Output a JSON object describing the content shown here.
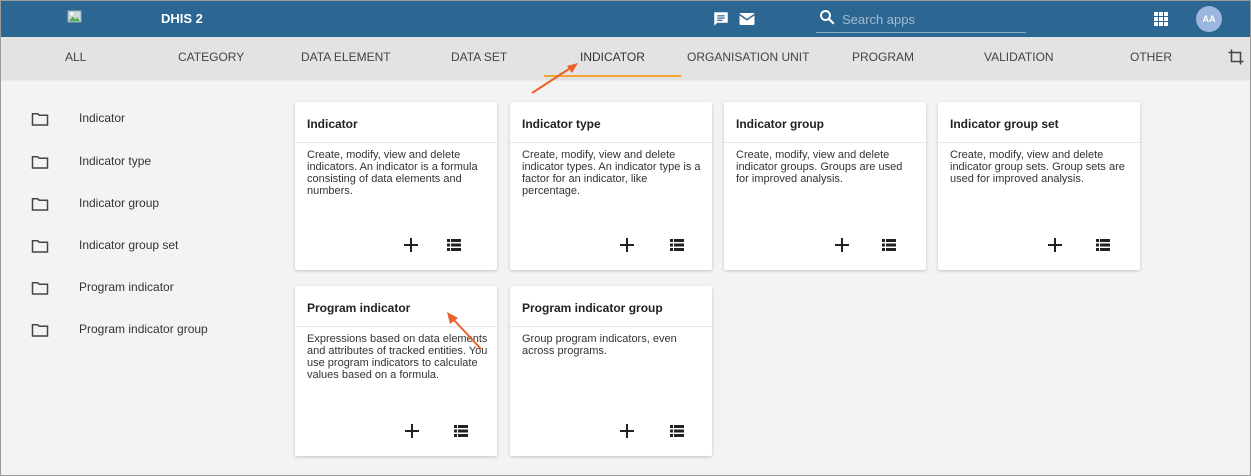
{
  "header": {
    "app_title": "DHIS 2",
    "search_placeholder": "Search apps",
    "avatar_initials": "AA",
    "color": "#2c6693"
  },
  "tabs": [
    {
      "label": "ALL"
    },
    {
      "label": "CATEGORY"
    },
    {
      "label": "DATA ELEMENT"
    },
    {
      "label": "DATA SET"
    },
    {
      "label": "INDICATOR",
      "active": true
    },
    {
      "label": "ORGANISATION UNIT"
    },
    {
      "label": "PROGRAM"
    },
    {
      "label": "VALIDATION"
    },
    {
      "label": "OTHER"
    }
  ],
  "accent_color": "#f2a534",
  "sidebar": {
    "items": [
      {
        "label": "Indicator"
      },
      {
        "label": "Indicator type"
      },
      {
        "label": "Indicator group"
      },
      {
        "label": "Indicator group set"
      },
      {
        "label": "Program indicator"
      },
      {
        "label": "Program indicator group"
      }
    ]
  },
  "cards": [
    {
      "title": "Indicator",
      "description": "Create, modify, view and delete indicators. An indicator is a formula consisting of data elements and numbers."
    },
    {
      "title": "Indicator type",
      "description": "Create, modify, view and delete indicator types. An indicator type is a factor for an indicator, like percentage."
    },
    {
      "title": "Indicator group",
      "description": "Create, modify, view and delete indicator groups. Groups are used for improved analysis."
    },
    {
      "title": "Indicator group set",
      "description": "Create, modify, view and delete indicator group sets. Group sets are used for improved analysis."
    },
    {
      "title": "Program indicator",
      "description": "Expressions based on data elements and attributes of tracked entities. You use program indicators to calculate values based on a formula."
    },
    {
      "title": "Program indicator group",
      "description": "Group program indicators, even across programs."
    }
  ],
  "icons": {
    "header": [
      "image-icon",
      "chat-icon",
      "mail-icon",
      "search-icon",
      "apps-grid-icon"
    ],
    "card_actions": [
      "add-icon",
      "list-icon"
    ],
    "sidebar": "folder-icon",
    "tabbar": "crop-icon"
  },
  "annotation_color": "#e8622a"
}
